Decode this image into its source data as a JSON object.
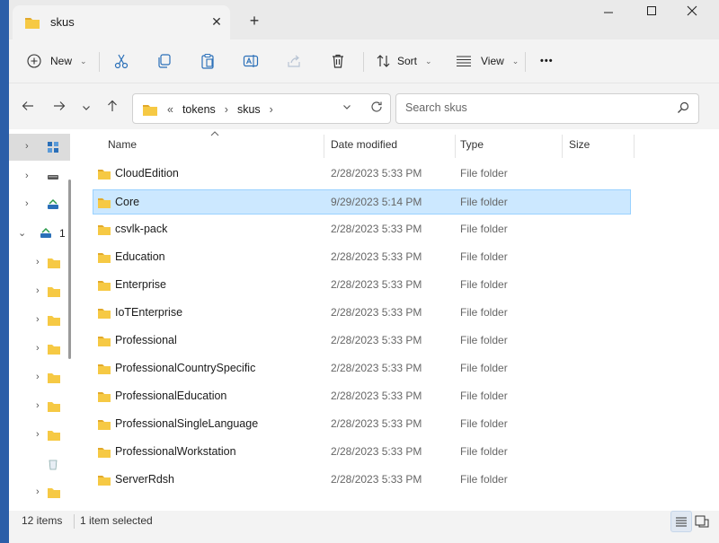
{
  "window": {
    "tab_title": "skus",
    "tab_close": "✕",
    "new_tab": "+",
    "minimize": "—",
    "maximize": "☐",
    "close": "✕"
  },
  "toolbar": {
    "new_label": "New",
    "sort_label": "Sort",
    "view_label": "View",
    "more_label": "•••"
  },
  "address": {
    "overflow": "«",
    "crumbs": [
      "tokens",
      "skus"
    ]
  },
  "search": {
    "placeholder": "Search skus"
  },
  "navpane": {
    "partial_label": "1"
  },
  "columns": {
    "name": "Name",
    "date": "Date modified",
    "type": "Type",
    "size": "Size"
  },
  "files": [
    {
      "name": "CloudEdition",
      "date": "2/28/2023 5:33 PM",
      "type": "File folder",
      "selected": false
    },
    {
      "name": "Core",
      "date": "9/29/2023 5:14 PM",
      "type": "File folder",
      "selected": true
    },
    {
      "name": "csvlk-pack",
      "date": "2/28/2023 5:33 PM",
      "type": "File folder",
      "selected": false
    },
    {
      "name": "Education",
      "date": "2/28/2023 5:33 PM",
      "type": "File folder",
      "selected": false
    },
    {
      "name": "Enterprise",
      "date": "2/28/2023 5:33 PM",
      "type": "File folder",
      "selected": false
    },
    {
      "name": "IoTEnterprise",
      "date": "2/28/2023 5:33 PM",
      "type": "File folder",
      "selected": false
    },
    {
      "name": "Professional",
      "date": "2/28/2023 5:33 PM",
      "type": "File folder",
      "selected": false
    },
    {
      "name": "ProfessionalCountrySpecific",
      "date": "2/28/2023 5:33 PM",
      "type": "File folder",
      "selected": false
    },
    {
      "name": "ProfessionalEducation",
      "date": "2/28/2023 5:33 PM",
      "type": "File folder",
      "selected": false
    },
    {
      "name": "ProfessionalSingleLanguage",
      "date": "2/28/2023 5:33 PM",
      "type": "File folder",
      "selected": false
    },
    {
      "name": "ProfessionalWorkstation",
      "date": "2/28/2023 5:33 PM",
      "type": "File folder",
      "selected": false
    },
    {
      "name": "ServerRdsh",
      "date": "2/28/2023 5:33 PM",
      "type": "File folder",
      "selected": false
    }
  ],
  "status": {
    "item_count": "12 items",
    "selected": "1 item selected"
  },
  "colors": {
    "folder": "#f6c944",
    "selection": "#cce8ff",
    "desktop": "#2b5ea8"
  }
}
